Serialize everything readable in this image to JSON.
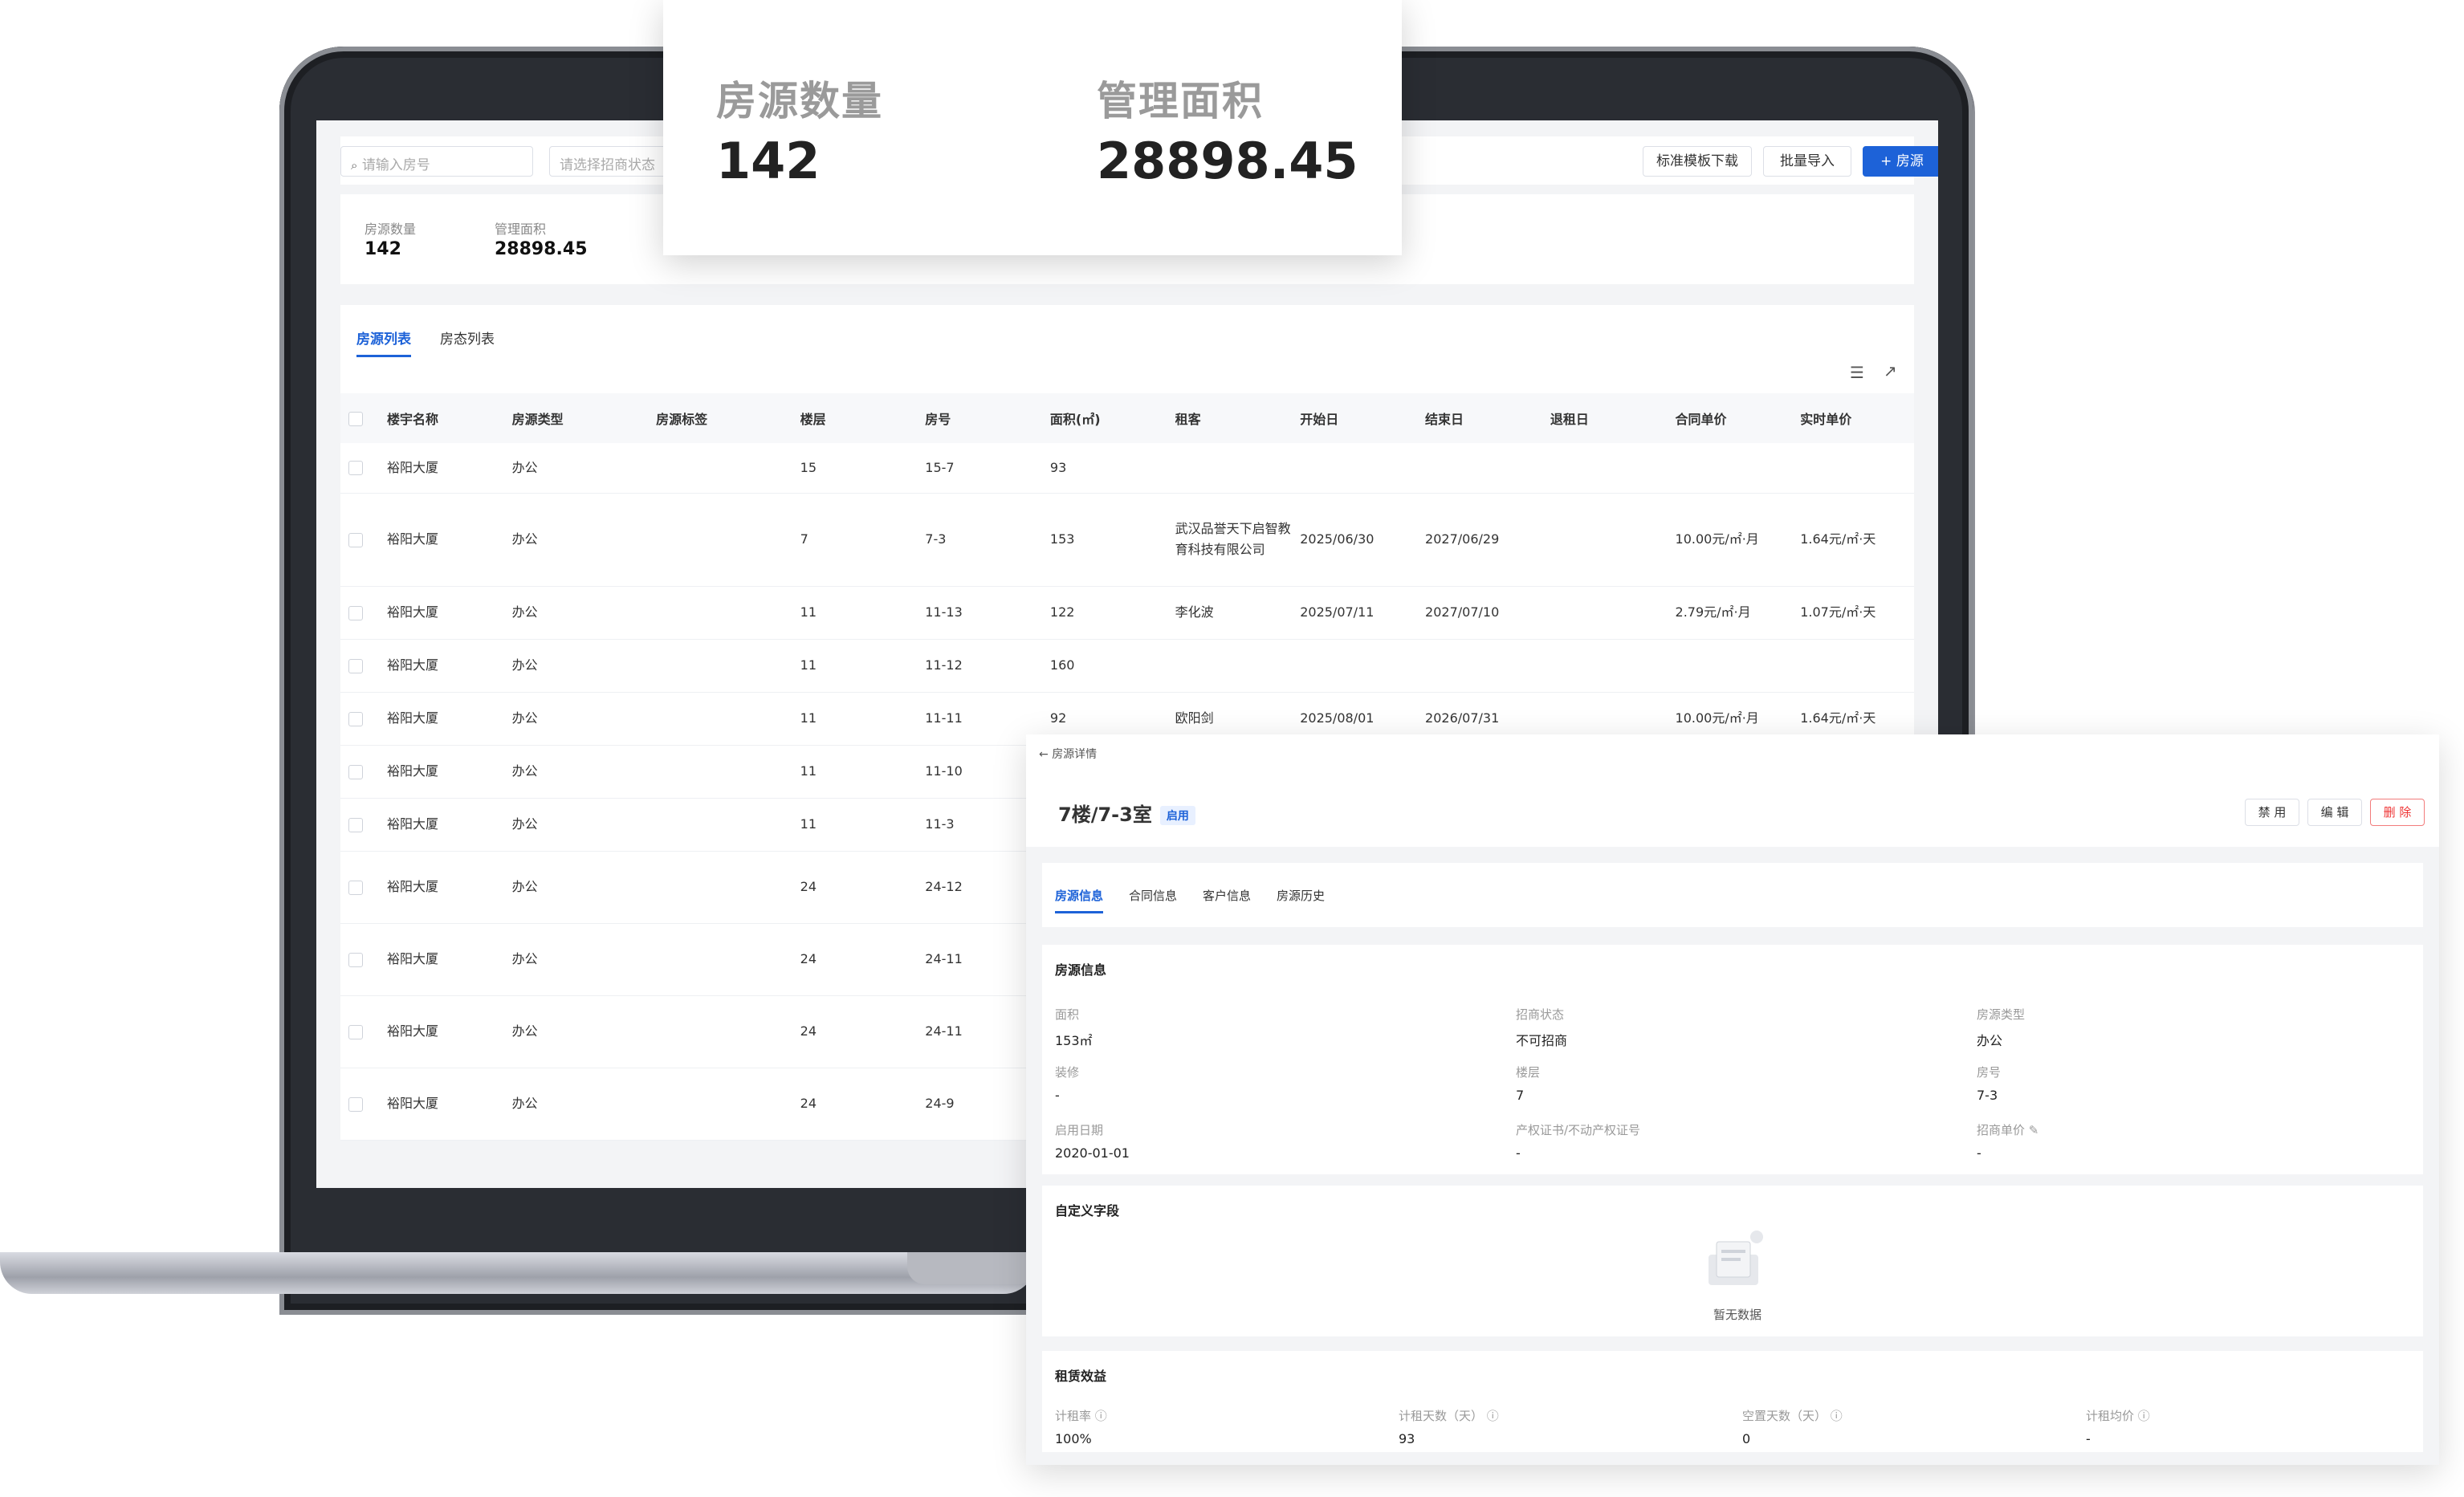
{
  "list": {
    "search_placeholder": "请输入房号",
    "status_placeholder": "请选择招商状态",
    "template_button": "标准模板下载",
    "import_button": "批量导入",
    "add_button": "+ 房源",
    "stats": {
      "count_label": "房源数量",
      "count_value": "142",
      "area_label": "管理面积",
      "area_value": "28898.45"
    },
    "tabs": [
      "房源列表",
      "房态列表"
    ],
    "columns": [
      "楼宇名称",
      "房源类型",
      "房源标签",
      "楼层",
      "房号",
      "面积(㎡)",
      "租客",
      "开始日",
      "结束日",
      "退租日",
      "合同单价",
      "实时单价"
    ],
    "rows": [
      [
        "裕阳大厦",
        "办公",
        "",
        "15",
        "15-7",
        "93",
        "",
        "",
        "",
        "",
        "",
        ""
      ],
      [
        "裕阳大厦",
        "办公",
        "",
        "7",
        "7-3",
        "153",
        "武汉品誉天下启智教育科技有限公司",
        "2025/06/30",
        "2027/06/29",
        "",
        "10.00元/㎡·月",
        "1.64元/㎡·天"
      ],
      [
        "裕阳大厦",
        "办公",
        "",
        "11",
        "11-13",
        "122",
        "李化波",
        "2025/07/11",
        "2027/07/10",
        "",
        "2.79元/㎡·月",
        "1.07元/㎡·天"
      ],
      [
        "裕阳大厦",
        "办公",
        "",
        "11",
        "11-12",
        "160",
        "",
        "",
        "",
        "",
        "",
        ""
      ],
      [
        "裕阳大厦",
        "办公",
        "",
        "11",
        "11-11",
        "92",
        "欧阳剑",
        "2025/08/01",
        "2026/07/31",
        "",
        "10.00元/㎡·月",
        "1.64元/㎡·天"
      ],
      [
        "裕阳大厦",
        "办公",
        "",
        "11",
        "11-10",
        "",
        "",
        "",
        "",
        "",
        "",
        ""
      ],
      [
        "裕阳大厦",
        "办公",
        "",
        "11",
        "11-3",
        "",
        "",
        "",
        "",
        "",
        "",
        ""
      ],
      [
        "裕阳大厦",
        "办公",
        "",
        "24",
        "24-12",
        "",
        "",
        "",
        "",
        "",
        "",
        ""
      ],
      [
        "裕阳大厦",
        "办公",
        "",
        "24",
        "24-11",
        "",
        "",
        "",
        "",
        "",
        "",
        ""
      ],
      [
        "裕阳大厦",
        "办公",
        "",
        "24",
        "24-11",
        "",
        "",
        "",
        "",
        "",
        "",
        ""
      ],
      [
        "裕阳大厦",
        "办公",
        "",
        "24",
        "24-9",
        "",
        "",
        "",
        "",
        "",
        "",
        ""
      ]
    ]
  },
  "card": {
    "count_label": "房源数量",
    "count_value": "142",
    "area_label": "管理面积",
    "area_value": "28898.45"
  },
  "detail": {
    "back_label": "房源详情",
    "title": "7楼/7-3室",
    "status_tag": "启用",
    "btn_disable": "禁 用",
    "btn_edit": "编 辑",
    "btn_delete": "删 除",
    "tabs": [
      "房源信息",
      "合同信息",
      "客户信息",
      "房源历史"
    ],
    "info_title": "房源信息",
    "fields": [
      {
        "label": "面积",
        "value": "153㎡"
      },
      {
        "label": "招商状态",
        "value": "不可招商"
      },
      {
        "label": "房源类型",
        "value": "办公"
      },
      {
        "label": "装修",
        "value": "-"
      },
      {
        "label": "楼层",
        "value": "7"
      },
      {
        "label": "房号",
        "value": "7-3"
      },
      {
        "label": "启用日期",
        "value": "2020-01-01"
      },
      {
        "label": "产权证书/不动产权证号",
        "value": "-"
      },
      {
        "label": "招商单价",
        "value": "-"
      }
    ],
    "custom_title": "自定义字段",
    "empty_text": "暂无数据",
    "benefit_title": "租赁效益",
    "benefits": [
      {
        "label": "计租率",
        "value": "100%"
      },
      {
        "label": "计租天数（天）",
        "value": "93"
      },
      {
        "label": "空置天数（天）",
        "value": "0"
      },
      {
        "label": "计租均价",
        "value": "-"
      }
    ]
  }
}
